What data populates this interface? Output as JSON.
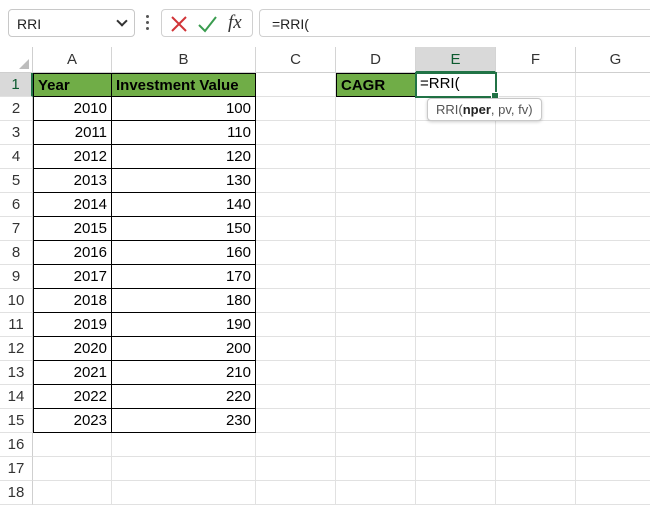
{
  "formula_bar": {
    "name_box": "RRI",
    "cancel_icon": "cancel-x-icon",
    "enter_icon": "checkmark-icon",
    "fx_label": "fx",
    "formula": "=RRI("
  },
  "columns": [
    "A",
    "B",
    "C",
    "D",
    "E",
    "F",
    "G"
  ],
  "active_column": "E",
  "rows": [
    "1",
    "2",
    "3",
    "4",
    "5",
    "6",
    "7",
    "8",
    "9",
    "10",
    "11",
    "12",
    "13",
    "14",
    "15",
    "16",
    "17",
    "18"
  ],
  "active_row": "1",
  "table": {
    "headers": {
      "year": "Year",
      "value": "Investment Value"
    },
    "data": [
      {
        "year": "2010",
        "value": "100"
      },
      {
        "year": "2011",
        "value": "110"
      },
      {
        "year": "2012",
        "value": "120"
      },
      {
        "year": "2013",
        "value": "130"
      },
      {
        "year": "2014",
        "value": "140"
      },
      {
        "year": "2015",
        "value": "150"
      },
      {
        "year": "2016",
        "value": "160"
      },
      {
        "year": "2017",
        "value": "170"
      },
      {
        "year": "2018",
        "value": "180"
      },
      {
        "year": "2019",
        "value": "190"
      },
      {
        "year": "2020",
        "value": "200"
      },
      {
        "year": "2021",
        "value": "210"
      },
      {
        "year": "2022",
        "value": "220"
      },
      {
        "year": "2023",
        "value": "230"
      }
    ]
  },
  "cagr": {
    "label": "CAGR",
    "editing_text": "=RRI("
  },
  "tooltip": {
    "fn": "RRI(",
    "arg1": "nper",
    "rest": ", pv, fv)"
  },
  "colors": {
    "header_fill": "#70ad47",
    "accent": "#217346"
  }
}
